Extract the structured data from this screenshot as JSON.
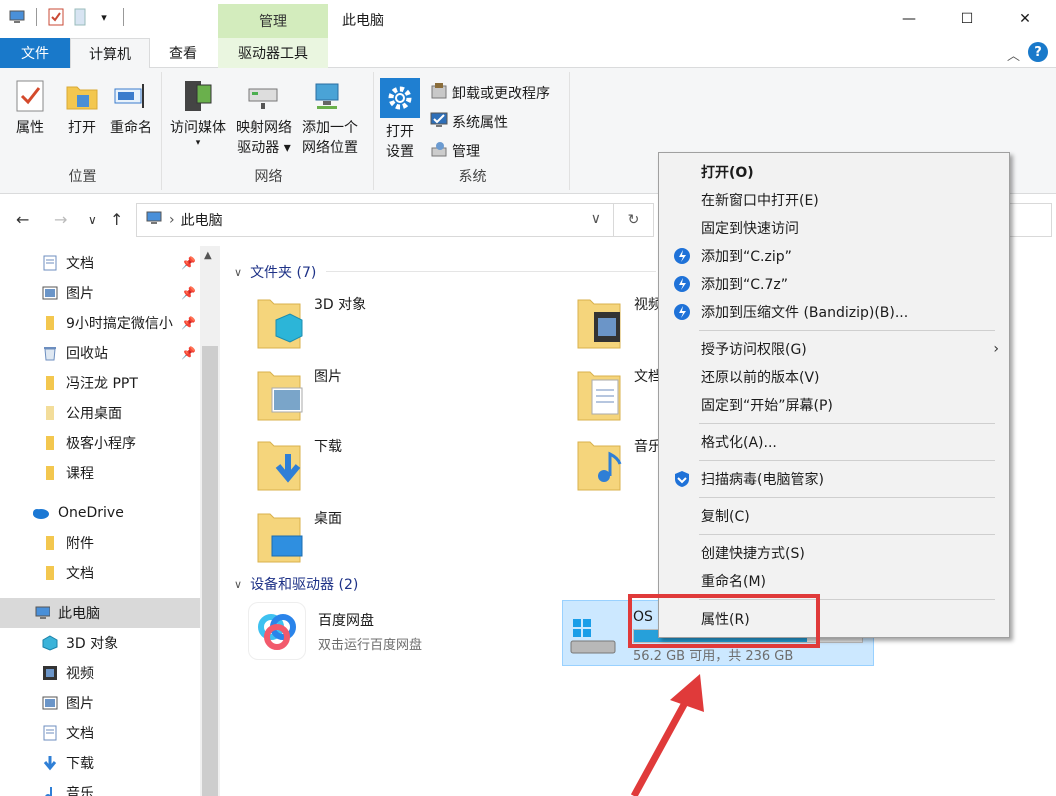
{
  "titlebar": {
    "context_tab_header": "管理",
    "window_title": "此电脑",
    "minimize": "—",
    "maximize": "☐",
    "close": "✕"
  },
  "tabs": {
    "file": "文件",
    "computer": "计算机",
    "view": "查看",
    "drive_tools": "驱动器工具"
  },
  "ribbon": {
    "location": {
      "title": "位置",
      "properties": "属性",
      "open": "打开",
      "rename": "重命名"
    },
    "network": {
      "title": "网络",
      "access_media": "访问媒体",
      "map_drive_1": "映射网络",
      "map_drive_2": "驱动器",
      "add_location_1": "添加一个",
      "add_location_2": "网络位置"
    },
    "system": {
      "title": "系统",
      "open_settings_1": "打开",
      "open_settings_2": "设置",
      "uninstall": "卸载或更改程序",
      "system_props": "系统属性",
      "manage": "管理"
    }
  },
  "address": {
    "path": "此电脑",
    "separator": "›"
  },
  "navpane": {
    "items": [
      {
        "label": "文档",
        "pinned": true
      },
      {
        "label": "图片",
        "pinned": true
      },
      {
        "label": "9小时搞定微信小",
        "pinned": true
      },
      {
        "label": "回收站",
        "pinned": true
      },
      {
        "label": "冯汪龙 PPT",
        "pinned": false
      },
      {
        "label": "公用桌面",
        "pinned": false
      },
      {
        "label": "极客小程序",
        "pinned": false
      },
      {
        "label": "课程",
        "pinned": false
      },
      {
        "label": "OneDrive",
        "pinned": false
      },
      {
        "label": "附件",
        "pinned": false
      },
      {
        "label": "文档",
        "pinned": false
      },
      {
        "label": "此电脑",
        "pinned": false
      },
      {
        "label": "3D 对象",
        "pinned": false
      },
      {
        "label": "视频",
        "pinned": false
      },
      {
        "label": "图片",
        "pinned": false
      },
      {
        "label": "文档",
        "pinned": false
      },
      {
        "label": "下载",
        "pinned": false
      },
      {
        "label": "音乐",
        "pinned": false
      }
    ]
  },
  "content": {
    "folders_header": "文件夹 (7)",
    "folders": [
      {
        "label": "3D 对象"
      },
      {
        "label": "视频"
      },
      {
        "label": "图片"
      },
      {
        "label": "文档"
      },
      {
        "label": "下载"
      },
      {
        "label": "音乐"
      },
      {
        "label": "桌面"
      }
    ],
    "devices_header": "设备和驱动器 (2)",
    "baidu": {
      "name": "百度网盘",
      "desc": "双击运行百度网盘"
    },
    "os_drive": {
      "name": "OS",
      "desc": "56.2 GB 可用，共 236 GB"
    }
  },
  "context_menu": {
    "open": "打开(O)",
    "open_new_window": "在新窗口中打开(E)",
    "pin_quick_access": "固定到快速访问",
    "add_zip": "添加到“C.zip”",
    "add_7z": "添加到“C.7z”",
    "add_bandizip": "添加到压缩文件 (Bandizip)(B)...",
    "give_access": "授予访问权限(G)",
    "restore_prev": "还原以前的版本(V)",
    "pin_start": "固定到“开始”屏幕(P)",
    "format": "格式化(A)...",
    "scan_virus": "扫描病毒(电脑管家)",
    "copy": "复制(C)",
    "create_shortcut": "创建快捷方式(S)",
    "rename": "重命名(M)",
    "properties": "属性(R)"
  },
  "colors": {
    "accent": "#1979ca",
    "highlight_red": "#e03a3a",
    "ctx_tab": "#d3ecbd"
  }
}
